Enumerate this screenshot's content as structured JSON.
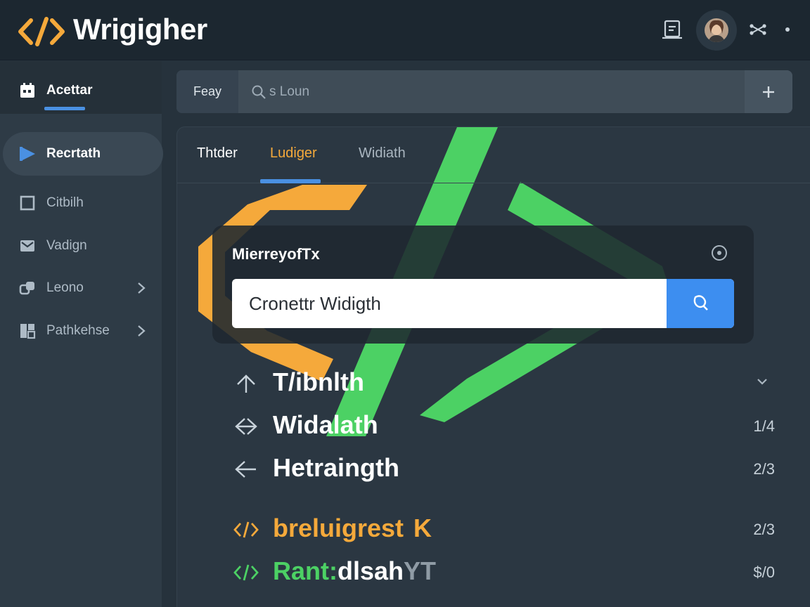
{
  "app": {
    "title": "Wrigigher",
    "colors": {
      "accent_orange": "#f5a93b",
      "accent_green": "#4cd164",
      "accent_blue": "#4a90e2"
    }
  },
  "header": {
    "icons": [
      "code-brackets-icon",
      "note-icon",
      "avatar",
      "share-icon",
      "more-icon"
    ]
  },
  "sidebar": {
    "header_label": "Acettar",
    "items": [
      {
        "label": "Recrtath",
        "icon": "play-icon",
        "active": true
      },
      {
        "label": "Citbilh",
        "icon": "square-icon",
        "active": false
      },
      {
        "label": "Vadign",
        "icon": "mail-icon",
        "active": false
      },
      {
        "label": "Leono",
        "icon": "link-icon",
        "active": false,
        "has_submenu": true
      },
      {
        "label": "Pathkehse",
        "icon": "grid-icon",
        "active": false,
        "has_submenu": true
      }
    ]
  },
  "toolbar": {
    "label": "Feay",
    "search_placeholder": "s Loun",
    "add_icon": "plus-icon"
  },
  "tabs": [
    {
      "label": "Thtder",
      "active": false
    },
    {
      "label": "Ludiger",
      "active": true
    },
    {
      "label": "Widiath",
      "active": false
    }
  ],
  "card": {
    "title": "MierreyofTx",
    "input_value": "Cronettr Widigth",
    "search_icon": "search-icon"
  },
  "rows": [
    {
      "icon": "arrow-up-icon",
      "label": "T/ibnlth",
      "value": ""
    },
    {
      "icon": "diamond-arrow-icon",
      "label": "Widalath",
      "value": "1/4"
    },
    {
      "icon": "arrow-left-icon",
      "label": "Hetraingth",
      "value": "2/3"
    },
    {
      "icon": "code-orange-icon",
      "label": "breluigrest",
      "suffix": "K",
      "value": "2/3"
    },
    {
      "icon": "code-green-icon",
      "label_prefix": "Rant:",
      "label_main": "dlsah",
      "label_suffix": "YT",
      "value": "$/0"
    }
  ]
}
